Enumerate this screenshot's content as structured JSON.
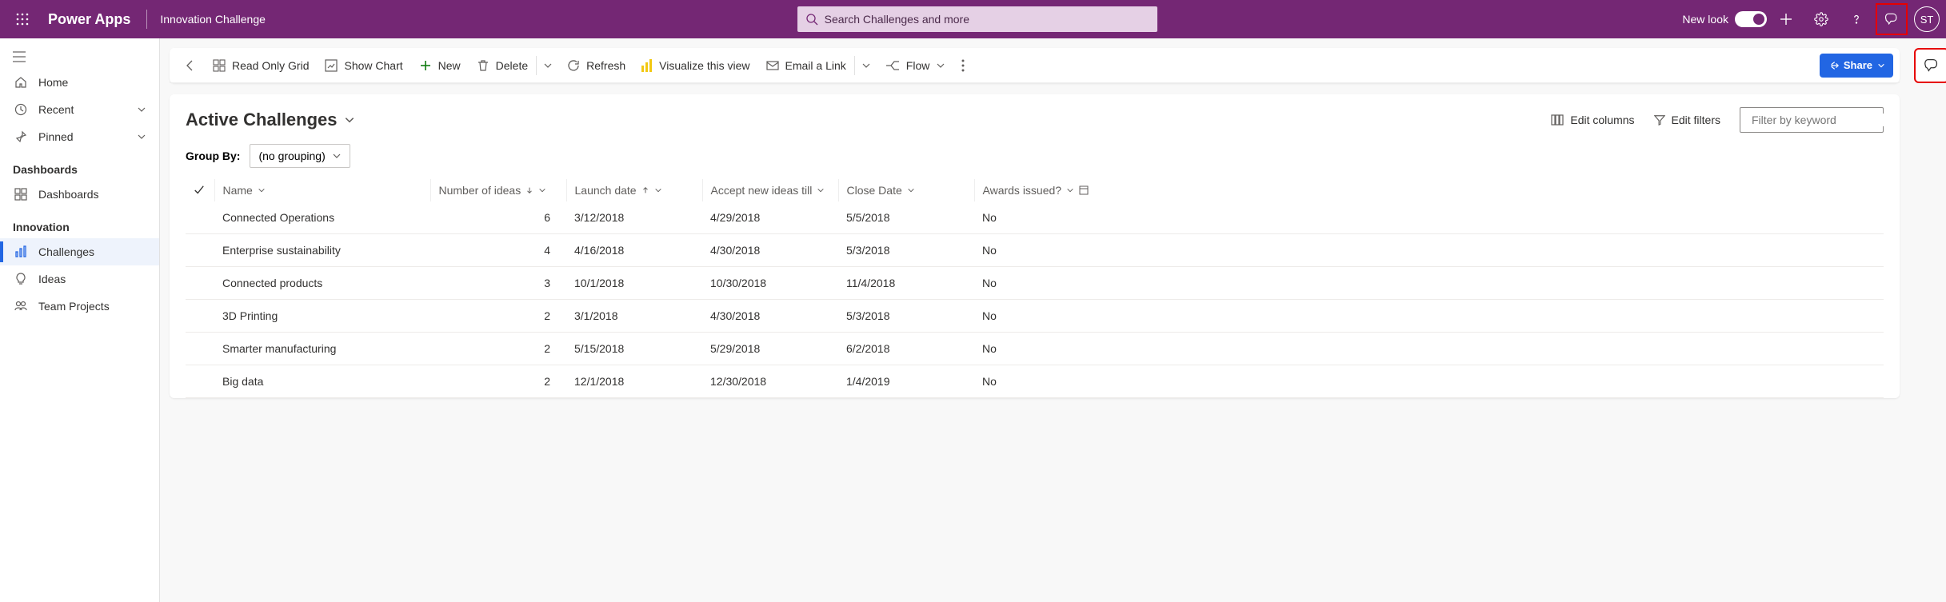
{
  "shell": {
    "brand": "Power Apps",
    "app_name": "Innovation Challenge",
    "search_placeholder": "Search Challenges and more",
    "new_look_label": "New look",
    "avatar_initials": "ST"
  },
  "sidebar": {
    "home": "Home",
    "recent": "Recent",
    "pinned": "Pinned",
    "dashboards_section": "Dashboards",
    "dashboards_item": "Dashboards",
    "innovation_section": "Innovation",
    "challenges": "Challenges",
    "ideas": "Ideas",
    "team_projects": "Team Projects"
  },
  "commands": {
    "read_only_grid": "Read Only Grid",
    "show_chart": "Show Chart",
    "new": "New",
    "delete": "Delete",
    "refresh": "Refresh",
    "visualize": "Visualize this view",
    "email": "Email a Link",
    "flow": "Flow",
    "share": "Share"
  },
  "view": {
    "title": "Active Challenges",
    "edit_columns": "Edit columns",
    "edit_filters": "Edit filters",
    "filter_placeholder": "Filter by keyword",
    "group_by_label": "Group By:",
    "group_by_value": "(no grouping)"
  },
  "columns": {
    "name": "Name",
    "num_ideas": "Number of ideas",
    "launch": "Launch date",
    "accept": "Accept new ideas till",
    "close": "Close Date",
    "awards": "Awards issued?"
  },
  "rows": [
    {
      "name": "Connected Operations",
      "ideas": "6",
      "launch": "3/12/2018",
      "accept": "4/29/2018",
      "close": "5/5/2018",
      "awards": "No"
    },
    {
      "name": "Enterprise sustainability",
      "ideas": "4",
      "launch": "4/16/2018",
      "accept": "4/30/2018",
      "close": "5/3/2018",
      "awards": "No"
    },
    {
      "name": "Connected products",
      "ideas": "3",
      "launch": "10/1/2018",
      "accept": "10/30/2018",
      "close": "11/4/2018",
      "awards": "No"
    },
    {
      "name": "3D Printing",
      "ideas": "2",
      "launch": "3/1/2018",
      "accept": "4/30/2018",
      "close": "5/3/2018",
      "awards": "No"
    },
    {
      "name": "Smarter manufacturing",
      "ideas": "2",
      "launch": "5/15/2018",
      "accept": "5/29/2018",
      "close": "6/2/2018",
      "awards": "No"
    },
    {
      "name": "Big data",
      "ideas": "2",
      "launch": "12/1/2018",
      "accept": "12/30/2018",
      "close": "1/4/2019",
      "awards": "No"
    }
  ]
}
